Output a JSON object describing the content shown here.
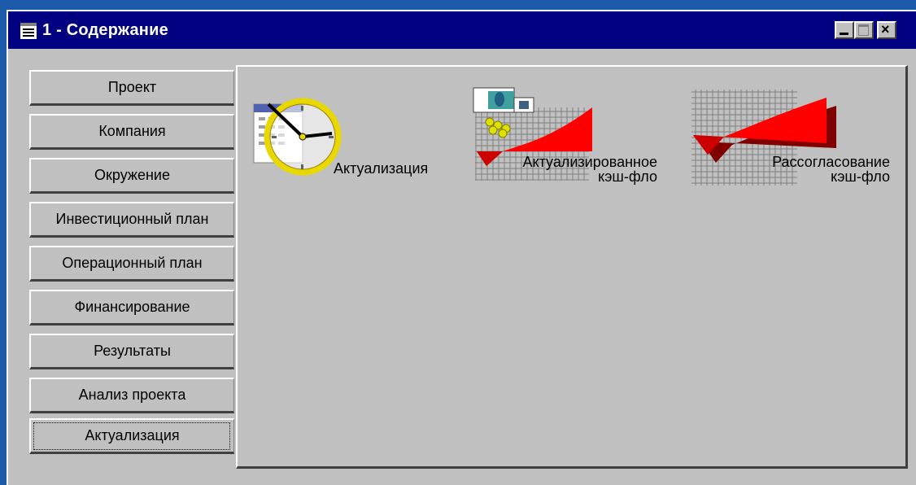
{
  "window": {
    "title": "1 - Содержание",
    "icon": "document-list-icon",
    "controls": [
      "minimize-icon",
      "maximize-icon",
      "close-icon"
    ]
  },
  "tabs": [
    {
      "label": "Проект"
    },
    {
      "label": "Компания"
    },
    {
      "label": "Окружение"
    },
    {
      "label": "Инвестиционный план"
    },
    {
      "label": "Операционный план"
    },
    {
      "label": "Финансирование"
    },
    {
      "label": "Результаты"
    },
    {
      "label": "Анализ проекта"
    },
    {
      "label": "Актуализация",
      "active": true
    }
  ],
  "panel": {
    "items": [
      {
        "label": "Актуализация",
        "icon": "clock-calendar-icon"
      },
      {
        "label_line1": "Актуализированное",
        "label_line2": "кэш-фло",
        "icon": "cash-flow-money-chart-icon"
      },
      {
        "label_line1": "Рассогласование",
        "label_line2": "кэш-фло",
        "icon": "cash-flow-divergence-chart-icon"
      }
    ]
  },
  "colors": {
    "titlebar": "#000080",
    "face": "#c0c0c0",
    "accent_red": "#ff0000",
    "desktop": "#1a5aa8"
  }
}
